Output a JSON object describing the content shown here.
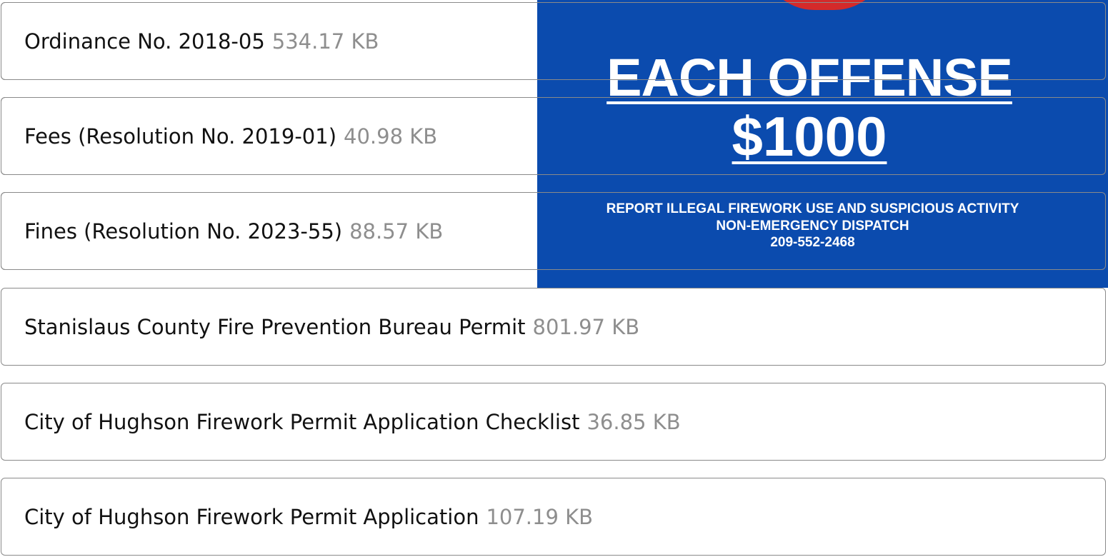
{
  "documents": [
    {
      "title": "Ordinance No. 2018-05",
      "size": "534.17 KB"
    },
    {
      "title": "Fees (Resolution No. 2019-01)",
      "size": "40.98 KB"
    },
    {
      "title": "Fines (Resolution No. 2023-55)",
      "size": "88.57 KB"
    },
    {
      "title": "Stanislaus County Fire Prevention Bureau Permit",
      "size": "801.97 KB"
    },
    {
      "title": "City of Hughson Firework Permit Application Checklist",
      "size": "36.85 KB"
    },
    {
      "title": "City of Hughson Firework Permit Application",
      "size": "107.19 KB"
    }
  ],
  "promo": {
    "heading": "EACH OFFENSE",
    "amount": "$1000",
    "line1": "REPORT ILLEGAL FIREWORK USE AND SUSPICIOUS ACTIVITY",
    "line2": "NON-EMERGENCY DISPATCH",
    "line3": "209-552-2468",
    "background_color": "#0b4bae",
    "accent_color": "#d42a2a"
  },
  "colors": {
    "text": "#111111",
    "size_text": "#8e8e8e",
    "border": "#8a8a8a"
  }
}
